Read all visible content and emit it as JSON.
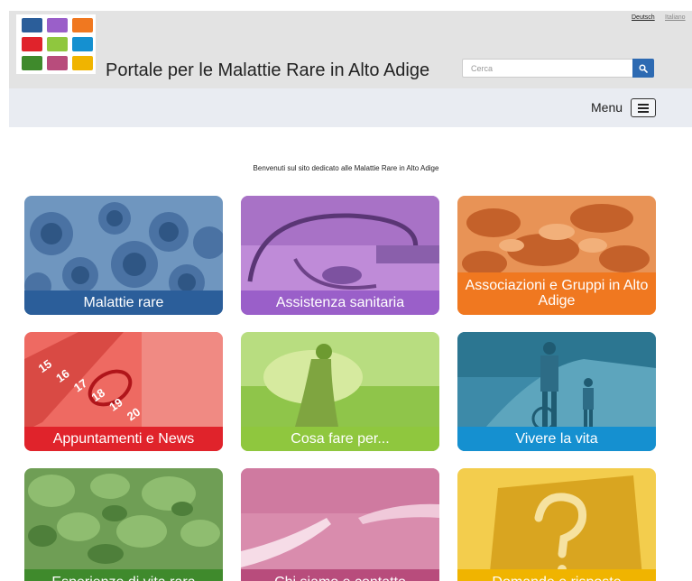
{
  "header": {
    "site_title": "Portale per le Malattie Rare in Alto Adige",
    "languages": [
      "Deutsch",
      "Italiano"
    ],
    "search": {
      "placeholder": "Cerca",
      "icon": "search-icon"
    },
    "logo": {
      "colors": [
        "#2b5e9a",
        "#9a5fc9",
        "#f07820",
        "#e0232b",
        "#8fc73e",
        "#1590d0",
        "#3f8a2c",
        "#b84c7c",
        "#f0b400"
      ]
    }
  },
  "menubar": {
    "label": "Menu",
    "icon": "hamburger-icon"
  },
  "welcome_text": "Benvenuti sul sito dedicato alle Malattie Rare in Alto Adige",
  "tiles": [
    {
      "label": "Malattie rare",
      "color": "#2b5e9a",
      "icon": "gears-medical-icon"
    },
    {
      "label": "Assistenza sanitaria",
      "color": "#9a5fc9",
      "icon": "stethoscope-icon"
    },
    {
      "label": "Associazioni e Gruppi in Alto Adige",
      "color": "#f07820",
      "icon": "joined-hands-icon"
    },
    {
      "label": "Appuntamenti e News",
      "color": "#e0232b",
      "icon": "calendar-icon"
    },
    {
      "label": "Cosa fare per...",
      "color": "#8fc73e",
      "icon": "meadow-icon"
    },
    {
      "label": "Vivere la vita",
      "color": "#1590d0",
      "icon": "walking-family-icon"
    },
    {
      "label": "Esperienze di vita rara",
      "color": "#3f8a2c",
      "icon": "pebbles-icon"
    },
    {
      "label": "Chi siamo e contatto",
      "color": "#b84c7c",
      "icon": "reaching-hands-icon"
    },
    {
      "label": "Domande e risposte",
      "color": "#f0b400",
      "icon": "question-mark-icon"
    }
  ]
}
